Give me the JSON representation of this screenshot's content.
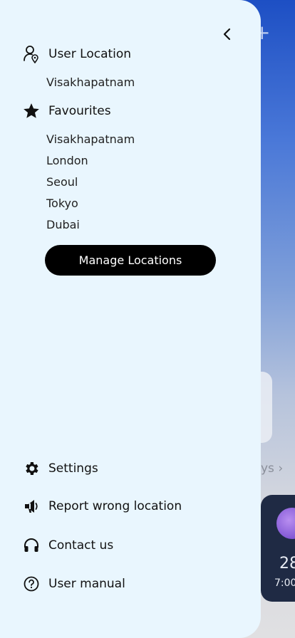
{
  "background": {
    "days_label": "ys",
    "forecast_temp": "28",
    "forecast_time": "7:00"
  },
  "drawer": {
    "user_location": {
      "title": "User Location",
      "icon": "user-location-icon",
      "value": "Visakhapatnam"
    },
    "favourites": {
      "title": "Favourites",
      "icon": "star-icon",
      "items": [
        "Visakhapatnam",
        "London",
        "Seoul",
        "Tokyo",
        "Dubai"
      ]
    },
    "manage_button": "Manage Locations",
    "menu": [
      {
        "label": "Settings",
        "icon": "gear-icon"
      },
      {
        "label": "Report wrong location",
        "icon": "megaphone-icon"
      },
      {
        "label": "Contact us",
        "icon": "headphones-icon"
      },
      {
        "label": "User manual",
        "icon": "help-circle-icon"
      }
    ]
  },
  "colors": {
    "drawer_bg": "#e9f6fe",
    "button_bg": "#000000",
    "button_text": "#ffffff",
    "text": "#111111"
  }
}
